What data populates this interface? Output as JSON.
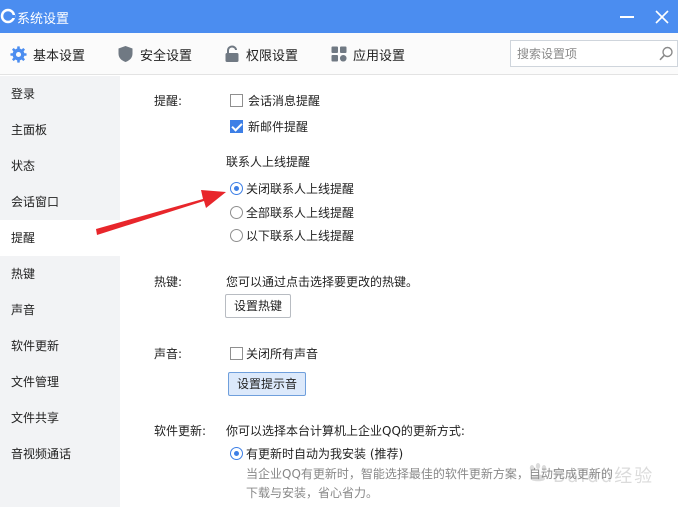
{
  "window": {
    "title": "系统设置"
  },
  "tabs": [
    {
      "label": "基本设置",
      "icon": "gear-icon",
      "active": true
    },
    {
      "label": "安全设置",
      "icon": "shield-icon"
    },
    {
      "label": "权限设置",
      "icon": "lock-icon"
    },
    {
      "label": "应用设置",
      "icon": "apps-icon"
    }
  ],
  "search": {
    "placeholder": "搜索设置项"
  },
  "sidebar": {
    "items": [
      {
        "label": "登录"
      },
      {
        "label": "主面板"
      },
      {
        "label": "状态"
      },
      {
        "label": "会话窗口"
      },
      {
        "label": "提醒",
        "active": true
      },
      {
        "label": "热键"
      },
      {
        "label": "声音"
      },
      {
        "label": "软件更新"
      },
      {
        "label": "文件管理"
      },
      {
        "label": "文件共享"
      },
      {
        "label": "音视频通话"
      }
    ]
  },
  "reminder": {
    "label": "提醒:",
    "options": [
      {
        "label": "会话消息提醒",
        "checked": false
      },
      {
        "label": "新邮件提醒",
        "checked": true
      }
    ],
    "contact_heading": "联系人上线提醒",
    "contact_options": [
      {
        "label": "关闭联系人上线提醒",
        "selected": true
      },
      {
        "label": "全部联系人上线提醒",
        "selected": false
      },
      {
        "label": "以下联系人上线提醒",
        "selected": false
      }
    ]
  },
  "hotkey": {
    "label": "热键:",
    "description": "您可以通过点击选择要更改的热键。",
    "button": "设置热键"
  },
  "sound": {
    "label": "声音:",
    "option": {
      "label": "关闭所有声音",
      "checked": false
    },
    "button": "设置提示音"
  },
  "update": {
    "label": "软件更新:",
    "description": "你可以选择本台计算机上企业QQ的更新方式:",
    "option": {
      "label": "有更新时自动为我安装 (推荐)",
      "selected": true
    },
    "detail_line1": "当企业QQ有更新时，智能选择最佳的软件更新方案，自动完成更新的",
    "detail_line2": "下载与安装，省心省力。"
  },
  "watermark": {
    "text": "Baidu经验"
  },
  "colors": {
    "titlebar": "#4b8df0",
    "accent": "#3d7fe6",
    "arrow": "#e8262b",
    "sidebar_bg": "#f2f3f5"
  }
}
